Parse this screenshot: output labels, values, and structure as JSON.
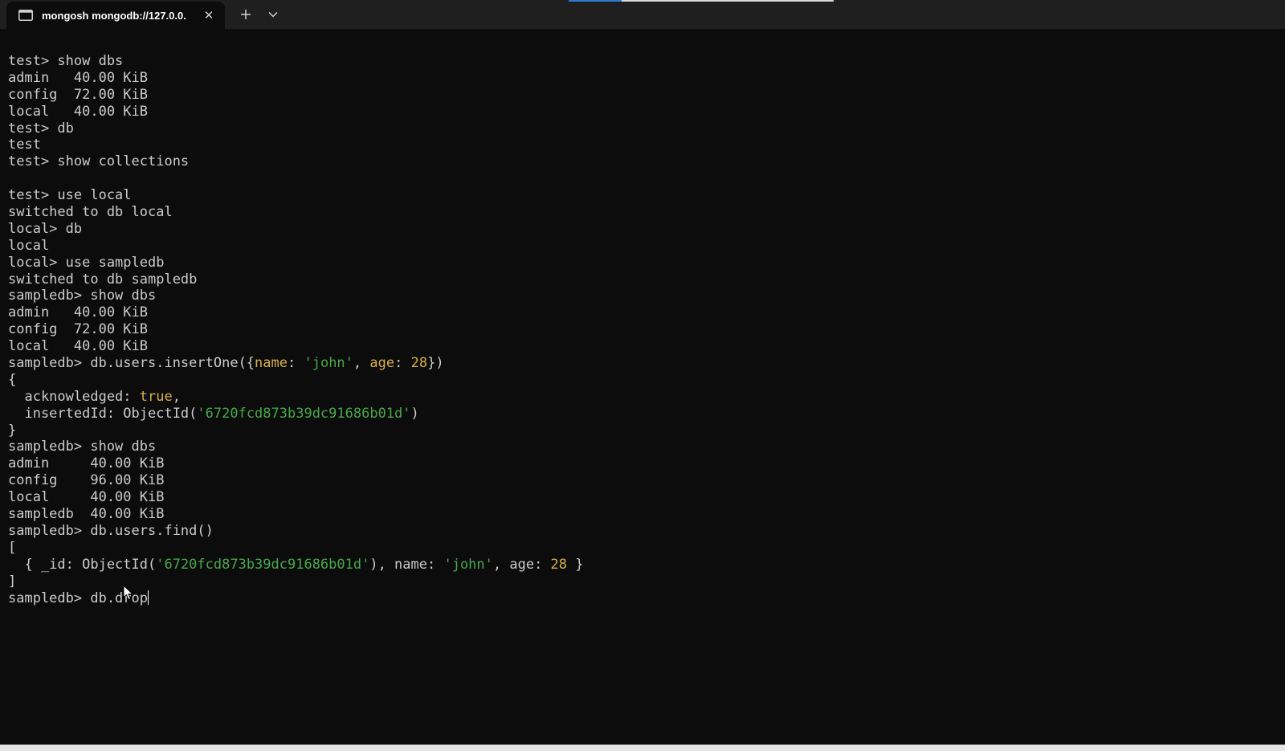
{
  "window": {
    "tab_title": "mongosh mongodb://127.0.0.",
    "tab_icon": "terminal-icon",
    "close_icon": "close-icon",
    "new_tab_icon": "plus-icon",
    "dropdown_icon": "chevron-down-icon",
    "progress_fraction": 0.2,
    "colors": {
      "background": "#0c0c0c",
      "titlebar": "#1f1f1f",
      "text": "#cccccc",
      "number": "#d7b247",
      "string": "#47a84a",
      "accent": "#2f7bd8"
    }
  },
  "terminal": {
    "lines": [
      [
        {
          "t": "test> show dbs"
        }
      ],
      [
        {
          "t": "admin   40.00 KiB"
        }
      ],
      [
        {
          "t": "config  72.00 KiB"
        }
      ],
      [
        {
          "t": "local   40.00 KiB"
        }
      ],
      [
        {
          "t": "test> db"
        }
      ],
      [
        {
          "t": "test"
        }
      ],
      [
        {
          "t": "test> show collections"
        }
      ],
      [
        {
          "t": ""
        }
      ],
      [
        {
          "t": "test> use local"
        }
      ],
      [
        {
          "t": "switched to db local"
        }
      ],
      [
        {
          "t": "local> db"
        }
      ],
      [
        {
          "t": "local"
        }
      ],
      [
        {
          "t": "local> use sampledb"
        }
      ],
      [
        {
          "t": "switched to db sampledb"
        }
      ],
      [
        {
          "t": "sampledb> show dbs"
        }
      ],
      [
        {
          "t": "admin   40.00 KiB"
        }
      ],
      [
        {
          "t": "config  72.00 KiB"
        }
      ],
      [
        {
          "t": "local   40.00 KiB"
        }
      ],
      [
        {
          "t": "sampledb> db.users.insertOne({"
        },
        {
          "t": "name",
          "c": "key"
        },
        {
          "t": ": "
        },
        {
          "t": "'john'",
          "c": "str"
        },
        {
          "t": ", "
        },
        {
          "t": "age",
          "c": "key"
        },
        {
          "t": ": "
        },
        {
          "t": "28",
          "c": "num"
        },
        {
          "t": "})"
        }
      ],
      [
        {
          "t": "{"
        }
      ],
      [
        {
          "t": "  acknowledged: "
        },
        {
          "t": "true",
          "c": "bool"
        },
        {
          "t": ","
        }
      ],
      [
        {
          "t": "  insertedId: ObjectId("
        },
        {
          "t": "'6720fcd873b39dc91686b01d'",
          "c": "str"
        },
        {
          "t": ")"
        }
      ],
      [
        {
          "t": "}"
        }
      ],
      [
        {
          "t": "sampledb> show dbs"
        }
      ],
      [
        {
          "t": "admin     40.00 KiB"
        }
      ],
      [
        {
          "t": "config    96.00 KiB"
        }
      ],
      [
        {
          "t": "local     40.00 KiB"
        }
      ],
      [
        {
          "t": "sampledb  40.00 KiB"
        }
      ],
      [
        {
          "t": "sampledb> db.users.find()"
        }
      ],
      [
        {
          "t": "["
        }
      ],
      [
        {
          "t": "  { _id: ObjectId("
        },
        {
          "t": "'6720fcd873b39dc91686b01d'",
          "c": "str"
        },
        {
          "t": "), name: "
        },
        {
          "t": "'john'",
          "c": "str"
        },
        {
          "t": ", age: "
        },
        {
          "t": "28",
          "c": "num"
        },
        {
          "t": " }"
        }
      ],
      [
        {
          "t": "]"
        }
      ],
      [
        {
          "t": "sampledb> db.drop"
        }
      ]
    ],
    "cursor_line": 32
  }
}
